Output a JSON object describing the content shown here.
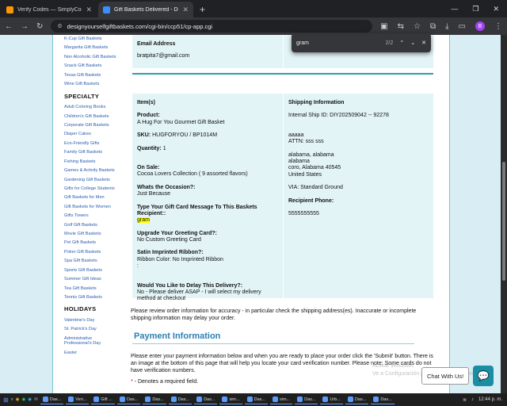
{
  "browser": {
    "tabs": [
      {
        "title": "Verify Codes — SimplyCodes",
        "active": false
      },
      {
        "title": "Gift Baskets Delivered - Design",
        "active": true
      }
    ],
    "url": "designyourselfgiftbaskets.com/cgi-bin/ccp51/cp-app.cgi",
    "profile_initial": "B"
  },
  "find": {
    "query": "gram",
    "count": "2/2"
  },
  "sidebar": {
    "links_top": [
      "K-Cup Gift Baskets",
      "Margarita Gift Baskets",
      "Non Alcoholic Gift Baskets",
      "Snack Gift Baskets",
      "Texas Gift Baskets",
      "Wine Gift Baskets"
    ],
    "specialty_heading": "SPECIALTY",
    "specialty_links": [
      "Adult Coloring Books",
      "Children's Gift Baskets",
      "Corporate Gift Baskets",
      "Diaper Cakes",
      "Eco-Friendly Gifts",
      "Family Gift Baskets",
      "Fishing Baskets",
      "Games & Activity Baskets",
      "Gardening Gift Baskets",
      "Gifts for College Students",
      "Gift Baskets for Men",
      "Gift Baskets for Women",
      "Gifts Towers",
      "Golf Gift Baskets",
      "Movie Gift Baskets",
      "Pet Gift Baskets",
      "Poker Gift Baskets",
      "Spa Gift Baskets",
      "Sports Gift Baskets",
      "Summer Gift Ideas",
      "Tea Gift Baskets",
      "Tennis Gift Baskets"
    ],
    "holidays_heading": "HOLIDAYS",
    "holiday_links": [
      "Valentine's Day",
      "St. Patrick's Day",
      "Administrative Professional's Day",
      "Easter"
    ]
  },
  "email": {
    "label": "Email Address",
    "value": "bratpita7@gmail.com"
  },
  "order": {
    "items_label": "Item(s)",
    "product_label": "Product:",
    "product_value": "A Hug For You Gourmet Gift Basket",
    "sku_label": "SKU:",
    "sku_value": "HUGFORYOU / BP1014M",
    "qty_label": "Quantity:",
    "qty_value": "1",
    "onsale_label": "On Sale:",
    "onsale_value": "Cocoa Lovers Collection ( 9 assorted flavors)",
    "occasion_label": "Whats the Occasion?:",
    "occasion_value": "Just Because",
    "message_label": "Type Your Gift Card Message To This Baskets Recipient::",
    "message_value": "gram",
    "greeting_label": "Upgrade Your Greeting Card?:",
    "greeting_value": "No Custom Greeting Card",
    "ribbon_label": "Satin Imprinted Ribbon?:",
    "ribbon_value": "Ribbon Color: No Imprinted Ribbon",
    "ribbon_extra": ":",
    "delay_label": "Would You Like to Delay This Delivery?:",
    "delay_value": "No - Please deliver ASAP - I will select my delivery method at checkout"
  },
  "shipping": {
    "heading": "Shipping Information",
    "ship_id": "Internal Ship ID: DIY202509042 -- 92278",
    "name": "aaaaa",
    "attn": "ATTN: sss sss",
    "addr1": "alabama, alabama",
    "addr2": "alabama",
    "addr3": "coro, Alabama 40545",
    "country": "United States",
    "via": "VIA: Standard Ground",
    "phone_label": "Recipient Phone:",
    "phone_value": "5555555555"
  },
  "review_text": "Please review order information for accuracy - in particular check the shipping address(es). Inaccurate or incomplete shipping information may delay your order.",
  "payment": {
    "heading": "Payment Information",
    "text": "Please enter your payment information below and when you are ready to place your order click the 'Submit' button. There is an image at the bottom of this page that will help you locate your card verification number. Please note: Some cards do not have verification numbers.",
    "required_star": "*",
    "required_note": "- Denotes a required field."
  },
  "chat": {
    "label": "Chat With Us!"
  },
  "watermark": {
    "line1": "Activar Windows",
    "line2": "Ve a Configuración para activar Windows."
  },
  "taskbar": {
    "items": [
      "Das...",
      "Veri...",
      "Gift ...",
      "Das...",
      "Das...",
      "Das...",
      "Das...",
      "sim...",
      "Das...",
      "sim...",
      "Das...",
      "Urb...",
      "Das...",
      "Das..."
    ],
    "time": "12:44 p. m."
  },
  "colors": {
    "accent_teal": "#2d9fb1",
    "panel_bg": "#e3f4f7",
    "link": "#2a5db0",
    "highlight": "#ffff00"
  }
}
